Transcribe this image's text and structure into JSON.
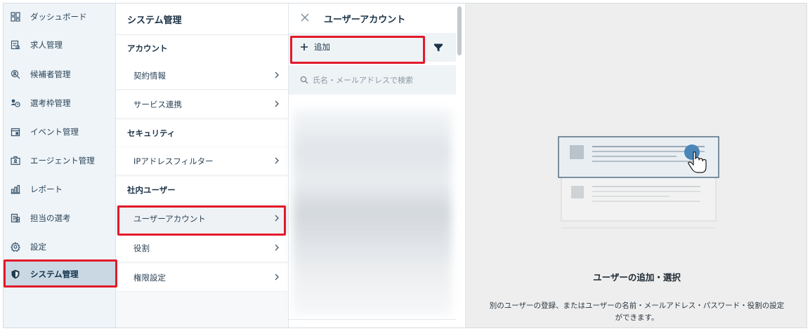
{
  "nav": {
    "items": [
      {
        "label": "ダッシュボード",
        "icon": "dashboard-icon"
      },
      {
        "label": "求人管理",
        "icon": "job-icon"
      },
      {
        "label": "候補者管理",
        "icon": "candidate-search-icon"
      },
      {
        "label": "選考枠管理",
        "icon": "slot-icon"
      },
      {
        "label": "イベント管理",
        "icon": "calendar-icon"
      },
      {
        "label": "エージェント管理",
        "icon": "agent-icon"
      },
      {
        "label": "レポート",
        "icon": "report-icon"
      },
      {
        "label": "担当の選考",
        "icon": "assigned-icon"
      },
      {
        "label": "設定",
        "icon": "gear-icon"
      },
      {
        "label": "システム管理",
        "icon": "shield-icon"
      }
    ]
  },
  "settings": {
    "title": "システム管理",
    "sections": {
      "account": "アカウント",
      "security": "セキュリティ",
      "internal_users": "社内ユーザー"
    },
    "rows": {
      "contract": "契約情報",
      "service_link": "サービス連携",
      "ip_filter": "IPアドレスフィルター",
      "user_account": "ユーザーアカウント",
      "role": "役割",
      "permission": "権限設定"
    }
  },
  "user_panel": {
    "title": "ユーザーアカウント",
    "add_label": "追加",
    "search_placeholder": "氏名・メールアドレスで検索"
  },
  "empty_state": {
    "title": "ユーザーの追加・選択",
    "line1": "別のユーザーの登録、またはユーザーの名前・メールアドレス・パスワード・役割の設定",
    "line2": "ができます。"
  },
  "colors": {
    "highlight": "#e3192b",
    "nav_bg": "#eef4f8",
    "nav_active": "#c9d8e3",
    "accent_blue": "#4a86b8"
  }
}
